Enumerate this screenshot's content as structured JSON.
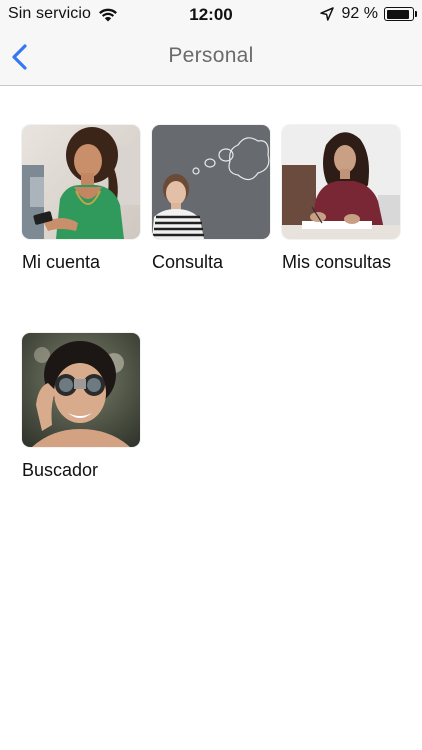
{
  "status_bar": {
    "carrier": "Sin servicio",
    "time": "12:00",
    "battery_text": "92 %",
    "battery_level": 0.92,
    "icons": [
      "wifi-icon",
      "location-arrow-icon",
      "battery-icon"
    ]
  },
  "nav": {
    "title": "Personal",
    "back_icon": "chevron-left-icon",
    "accent_color": "#3478f6"
  },
  "tiles": [
    {
      "label": "Mi cuenta",
      "image": "woman-with-phone"
    },
    {
      "label": "Consulta",
      "image": "woman-thinking-chalkboard"
    },
    {
      "label": "Mis consultas",
      "image": "woman-writing-at-desk"
    },
    {
      "label": "Buscador",
      "image": "woman-with-binoculars"
    }
  ]
}
